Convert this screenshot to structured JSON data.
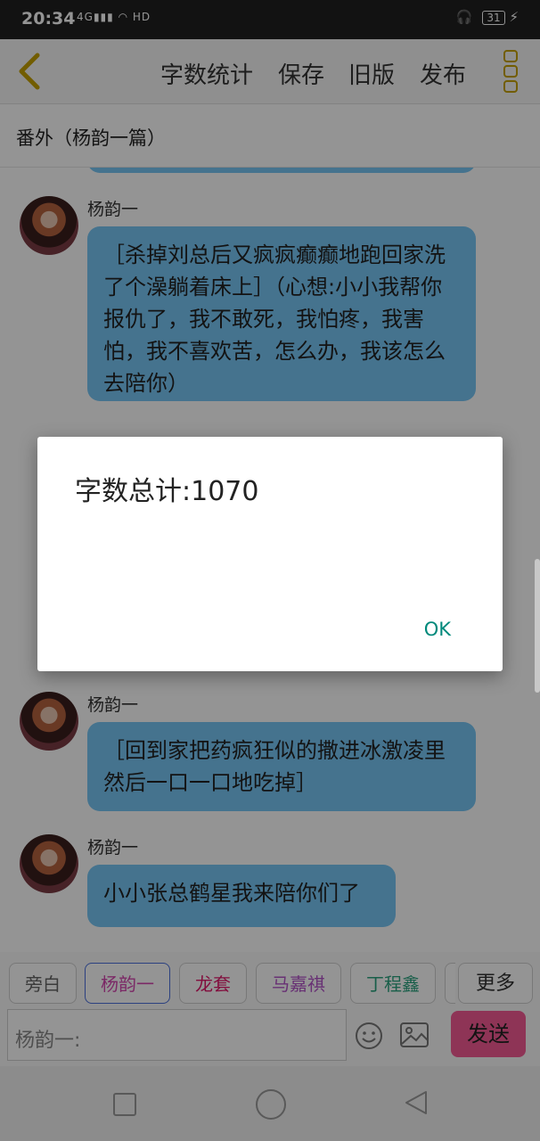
{
  "status_bar": {
    "time": "20:34",
    "signal": "4G",
    "hd": "HD",
    "battery": "31"
  },
  "toolbar": {
    "word_count": "字数统计",
    "save": "保存",
    "old_version": "旧版",
    "publish": "发布"
  },
  "chapter": {
    "title": "番外（杨韵一篇）"
  },
  "messages": [
    {
      "name": "杨韵一",
      "text": "［杀掉刘总后又疯疯癫癫地跑回家洗了个澡躺着床上］（心想:小小我帮你报仇了，我不敢死，我怕疼，我害怕，我不喜欢苦，怎么办，我该怎么去陪你）"
    },
    {
      "name": "杨韵一",
      "text": "［回到家把药疯狂似的撒进冰激凌里然后一口一口地吃掉］"
    },
    {
      "name": "杨韵一",
      "text": "小小张总鹤星我来陪你们了"
    }
  ],
  "dialog": {
    "message": "字数总计:1070",
    "ok": "OK"
  },
  "roles": [
    "旁白",
    "杨韵一",
    "龙套",
    "马嘉祺",
    "丁程鑫",
    "更多"
  ],
  "role_colors": {
    "旁白": "#666666",
    "杨韵一": "#d548b0",
    "龙套": "#e0186a",
    "马嘉祺": "#b355c9",
    "丁程鑫": "#2aa37e",
    "更多": "#333333"
  },
  "input": {
    "placeholder": "杨韵一:"
  },
  "send": {
    "label": "发送"
  },
  "colors": {
    "bubble": "#78c6f5",
    "send": "#f45b94",
    "accent_gold": "#c5a000"
  }
}
